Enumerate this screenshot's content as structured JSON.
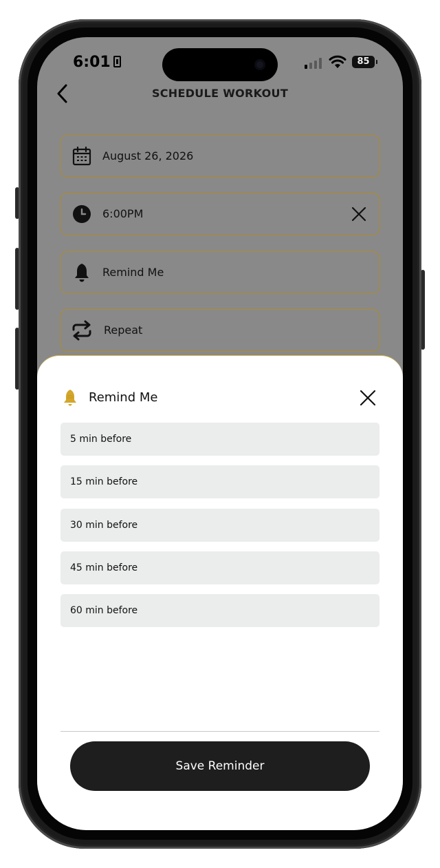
{
  "status_bar": {
    "time": "6:01",
    "battery": "85"
  },
  "header": {
    "title": "SCHEDULE WORKOUT"
  },
  "fields": {
    "date": "August 26, 2026",
    "time": "6:00PM",
    "remind": "Remind Me",
    "repeat": "Repeat"
  },
  "sheet": {
    "title": "Remind Me",
    "accent_color": "#d4a62a",
    "options": [
      "5 min before",
      "15 min before",
      "30 min before",
      "45 min before",
      "60 min before"
    ],
    "save_label": "Save Reminder"
  },
  "colors": {
    "field_border": "#b18a2c",
    "overlay": "#898989",
    "button": "#1e1e1e"
  }
}
